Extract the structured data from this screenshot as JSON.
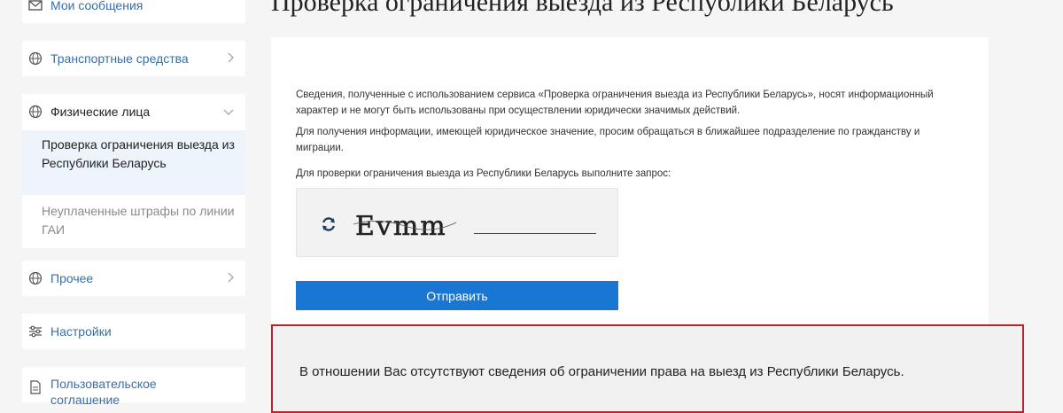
{
  "sidebar": {
    "my_messages": "Мои сообщения",
    "vehicles": "Транспортные средства",
    "individuals": "Физические лица",
    "sub_items": [
      "Проверка ограничения выезда из Республики Беларусь",
      "Неуплаченные штрафы по линии ГАИ"
    ],
    "other": "Прочее",
    "settings": "Настройки",
    "user_agreement": "Пользовательское соглашение"
  },
  "main": {
    "title": "Проверка ограничения выезда из Республики Беларусь",
    "paragraphs": [
      "Сведения, полученные с использованием сервиса «Проверка ограничения выезда из Республики Беларусь», носят информационный характер и не могут быть использованы при осуществлении юридически значимых действий.",
      "Для получения информации, имеющей юридическое значение, просим обращаться в ближайшее подразделение по гражданству и миграции.",
      "Для проверки ограничения выезда из Республики Беларусь выполните запрос:"
    ],
    "captcha_text": "Evmm",
    "captcha_value": "",
    "submit_label": "Отправить",
    "result_text": "В отношении Вас отсутствуют сведения об ограничении права на выезд из Республики Беларусь."
  }
}
